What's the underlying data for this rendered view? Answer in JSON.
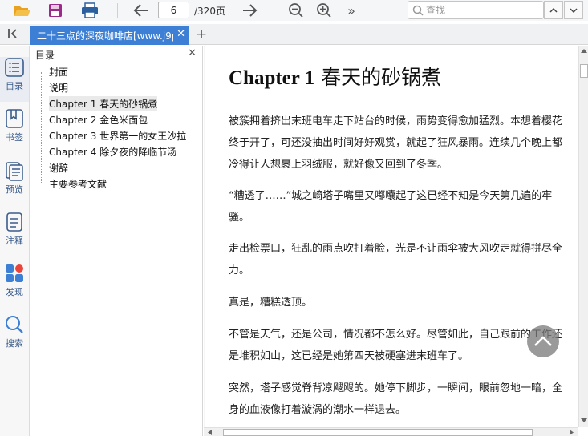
{
  "toolbar": {
    "current_page": "6",
    "page_total": "/320页",
    "search_placeholder": "查找",
    "more_label": "»"
  },
  "tabs": [
    {
      "title": "二十三点的深夜咖啡店[www.j9p"
    }
  ],
  "sidebar": {
    "items": [
      {
        "label": "目录",
        "icon": "toc-icon"
      },
      {
        "label": "书签",
        "icon": "bookmark-icon"
      },
      {
        "label": "预览",
        "icon": "preview-icon"
      },
      {
        "label": "注释",
        "icon": "annotation-icon"
      },
      {
        "label": "发现",
        "icon": "discover-icon"
      },
      {
        "label": "搜索",
        "icon": "search-icon"
      }
    ]
  },
  "toc": {
    "header": "目录",
    "items": [
      "封面",
      "说明",
      "Chapter 1 春天的砂锅煮",
      "Chapter 2 金色米面包",
      "Chapter 3 世界第一的女王沙拉",
      "Chapter 4 除夕夜的降临节汤",
      "谢辞",
      "主要参考文献"
    ],
    "selected_index": 2
  },
  "content": {
    "chapter_prefix": "Chapter 1",
    "chapter_name": " 春天的砂锅煮",
    "paragraphs": [
      "被簇拥着挤出末班电车走下站台的时候，雨势变得愈加猛烈。本想着樱花终于开了，可还没抽出时间好好观赏，就起了狂风暴雨。连续几个晚上都冷得让人想裹上羽绒服，就好像又回到了冬季。",
      "“糟透了……”城之崎塔子嘴里又嘟囔起了这已经不知是今天第几遍的牢骚。",
      "走出检票口，狂乱的雨点吹打着脸，光是不让雨伞被大风吹走就得拼尽全力。",
      "真是，糟糕透顶。",
      "不管是天气，还是公司，情况都不怎么好。尽管如此，自己跟前的工作还是堆积如山，这已经是她第四天被硬塞进末班车了。",
      "突然，塔子感觉脊背凉飕飕的。她停下脚步，一瞬间，眼前忽地一暗，全身的血液像打着漩涡的潮水一样退去。"
    ]
  },
  "colors": {
    "tab_active": "#3c7fd4",
    "sidebar_label": "#3a5c8c",
    "folder_icon": "#e8a21f",
    "save_icon": "#9b2a8a",
    "print_icon": "#2c5f9e"
  }
}
